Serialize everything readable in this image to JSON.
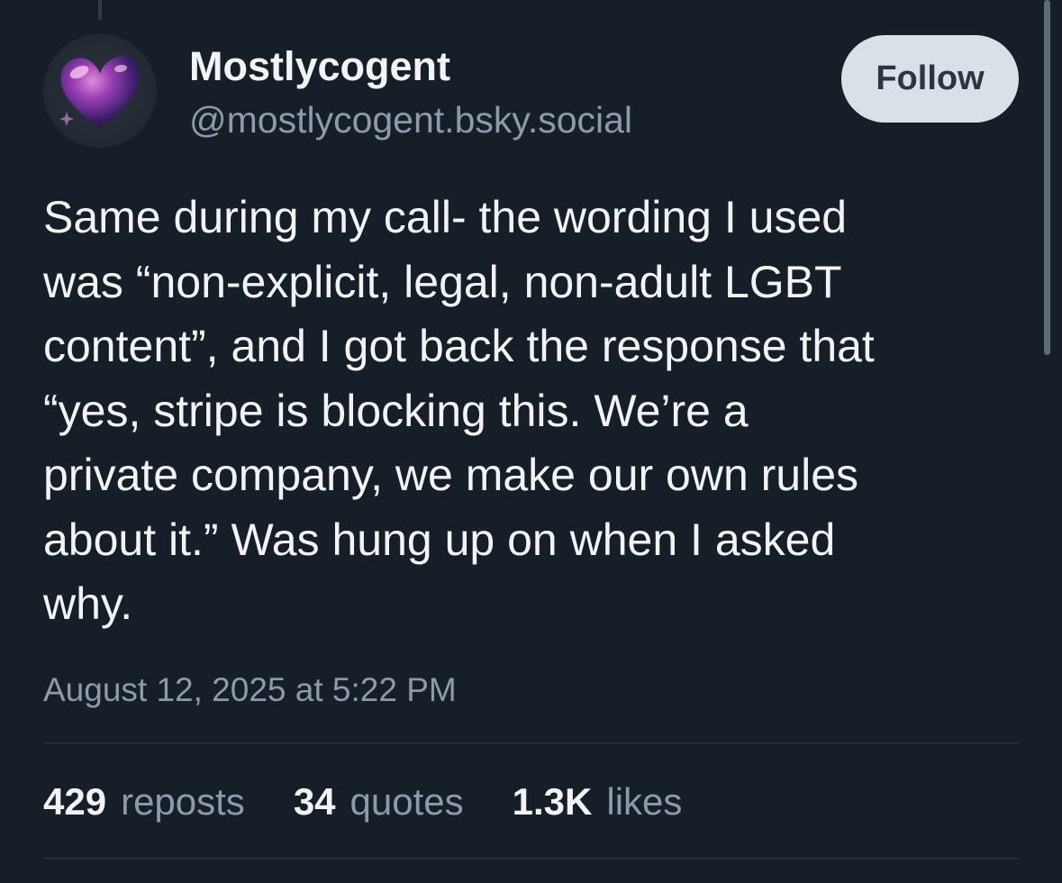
{
  "author": {
    "display_name": "Mostlycogent",
    "handle": "@mostlycogent.bsky.social",
    "avatar_icon": "purple-glass-heart-icon"
  },
  "follow_button": {
    "label": "Follow"
  },
  "post": {
    "text_lines": [
      "Same during my call- the wording I used",
      "was “non-explicit, legal, non-adult LGBT",
      "content”, and I got back the response that",
      "“yes, stripe is blocking this. We’re a",
      "private company, we make our own rules",
      "about it.” Was hung up on when I asked",
      "why."
    ],
    "timestamp": "August 12, 2025 at 5:22 PM"
  },
  "stats": {
    "reposts": {
      "count": "429",
      "label": "reposts"
    },
    "quotes": {
      "count": "34",
      "label": "quotes"
    },
    "likes": {
      "count": "1.3K",
      "label": "likes"
    }
  },
  "colors": {
    "background": "#161e27",
    "text_primary": "#f1f3f5",
    "text_secondary": "#8d9aa9",
    "follow_button_bg": "#d9e1e8",
    "divider": "#2e3a47"
  }
}
